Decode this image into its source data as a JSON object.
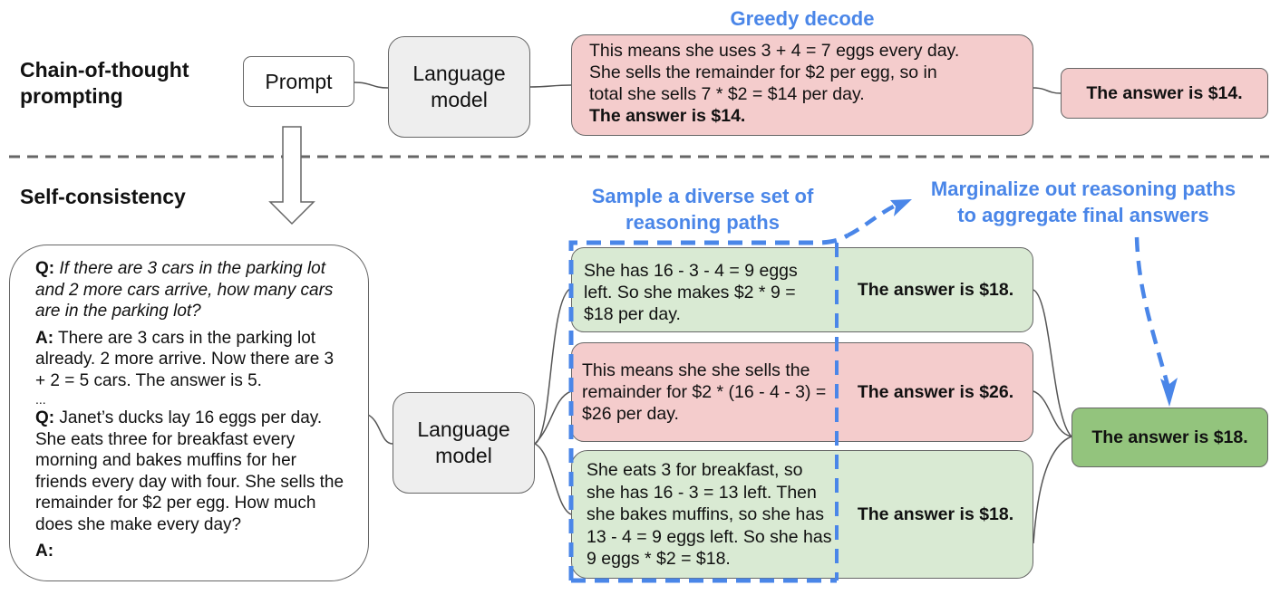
{
  "sections": {
    "cot": "Chain-of-thought prompting",
    "sc": "Self-consistency"
  },
  "top": {
    "prompt": "Prompt",
    "lm_line1": "Language",
    "lm_line2": "model",
    "greedy_label": "Greedy decode",
    "greedy_lines": [
      "This means she uses 3 + 4 = 7 eggs every day.",
      "She sells the remainder for $2 per egg, so in",
      "total she sells 7 * $2 = $14 per day."
    ],
    "greedy_answer": "The answer is $14.",
    "final_answer": "The answer is $14."
  },
  "bottom": {
    "prompt_box": {
      "q1_label": "Q:",
      "q1_text": "If there are 3 cars in the parking lot and 2 more cars arrive, how many cars are in the parking lot?",
      "a1_label": "A:",
      "a1_text": "There are 3 cars in the parking lot already. 2 more arrive. Now there are 3 + 2 = 5 cars. The answer is 5.",
      "ellipsis": "...",
      "q2_label": "Q:",
      "q2_text": "Janet’s ducks lay 16 eggs per day. She eats three for breakfast every morning and bakes muffins for her friends every day with four. She sells the remainder for $2 per egg. How much does she make every day?",
      "a2_label": "A:"
    },
    "lm_line1": "Language",
    "lm_line2": "model",
    "sample_label_1": "Sample a diverse set of",
    "sample_label_2": "reasoning paths",
    "marg_label_1": "Marginalize out reasoning paths",
    "marg_label_2": "to aggregate final answers",
    "paths": [
      {
        "reasoning": "She has 16 - 3 - 4 = 9 eggs left. So she makes $2 * 9 = $18 per day.",
        "answer": "The answer is $18.",
        "correct": true
      },
      {
        "reasoning": "This means she she sells the remainder for $2 * (16 - 4 - 3) = $26 per day.",
        "answer": "The answer is $26.",
        "correct": false
      },
      {
        "reasoning": "She eats 3 for breakfast, so she has 16 - 3 = 13 left. Then she bakes muffins, so she has 13 - 4 = 9 eggs left. So she has 9 eggs * $2 = $18.",
        "answer": "The answer is $18.",
        "correct": true
      }
    ],
    "final_answer": "The answer is $18."
  },
  "colors": {
    "accent_blue": "#4a86e8",
    "wrong_fill": "#f4cccc",
    "right_fill": "#d9ead3",
    "final_right_fill": "#93c47d",
    "lm_fill": "#eeeeee"
  }
}
